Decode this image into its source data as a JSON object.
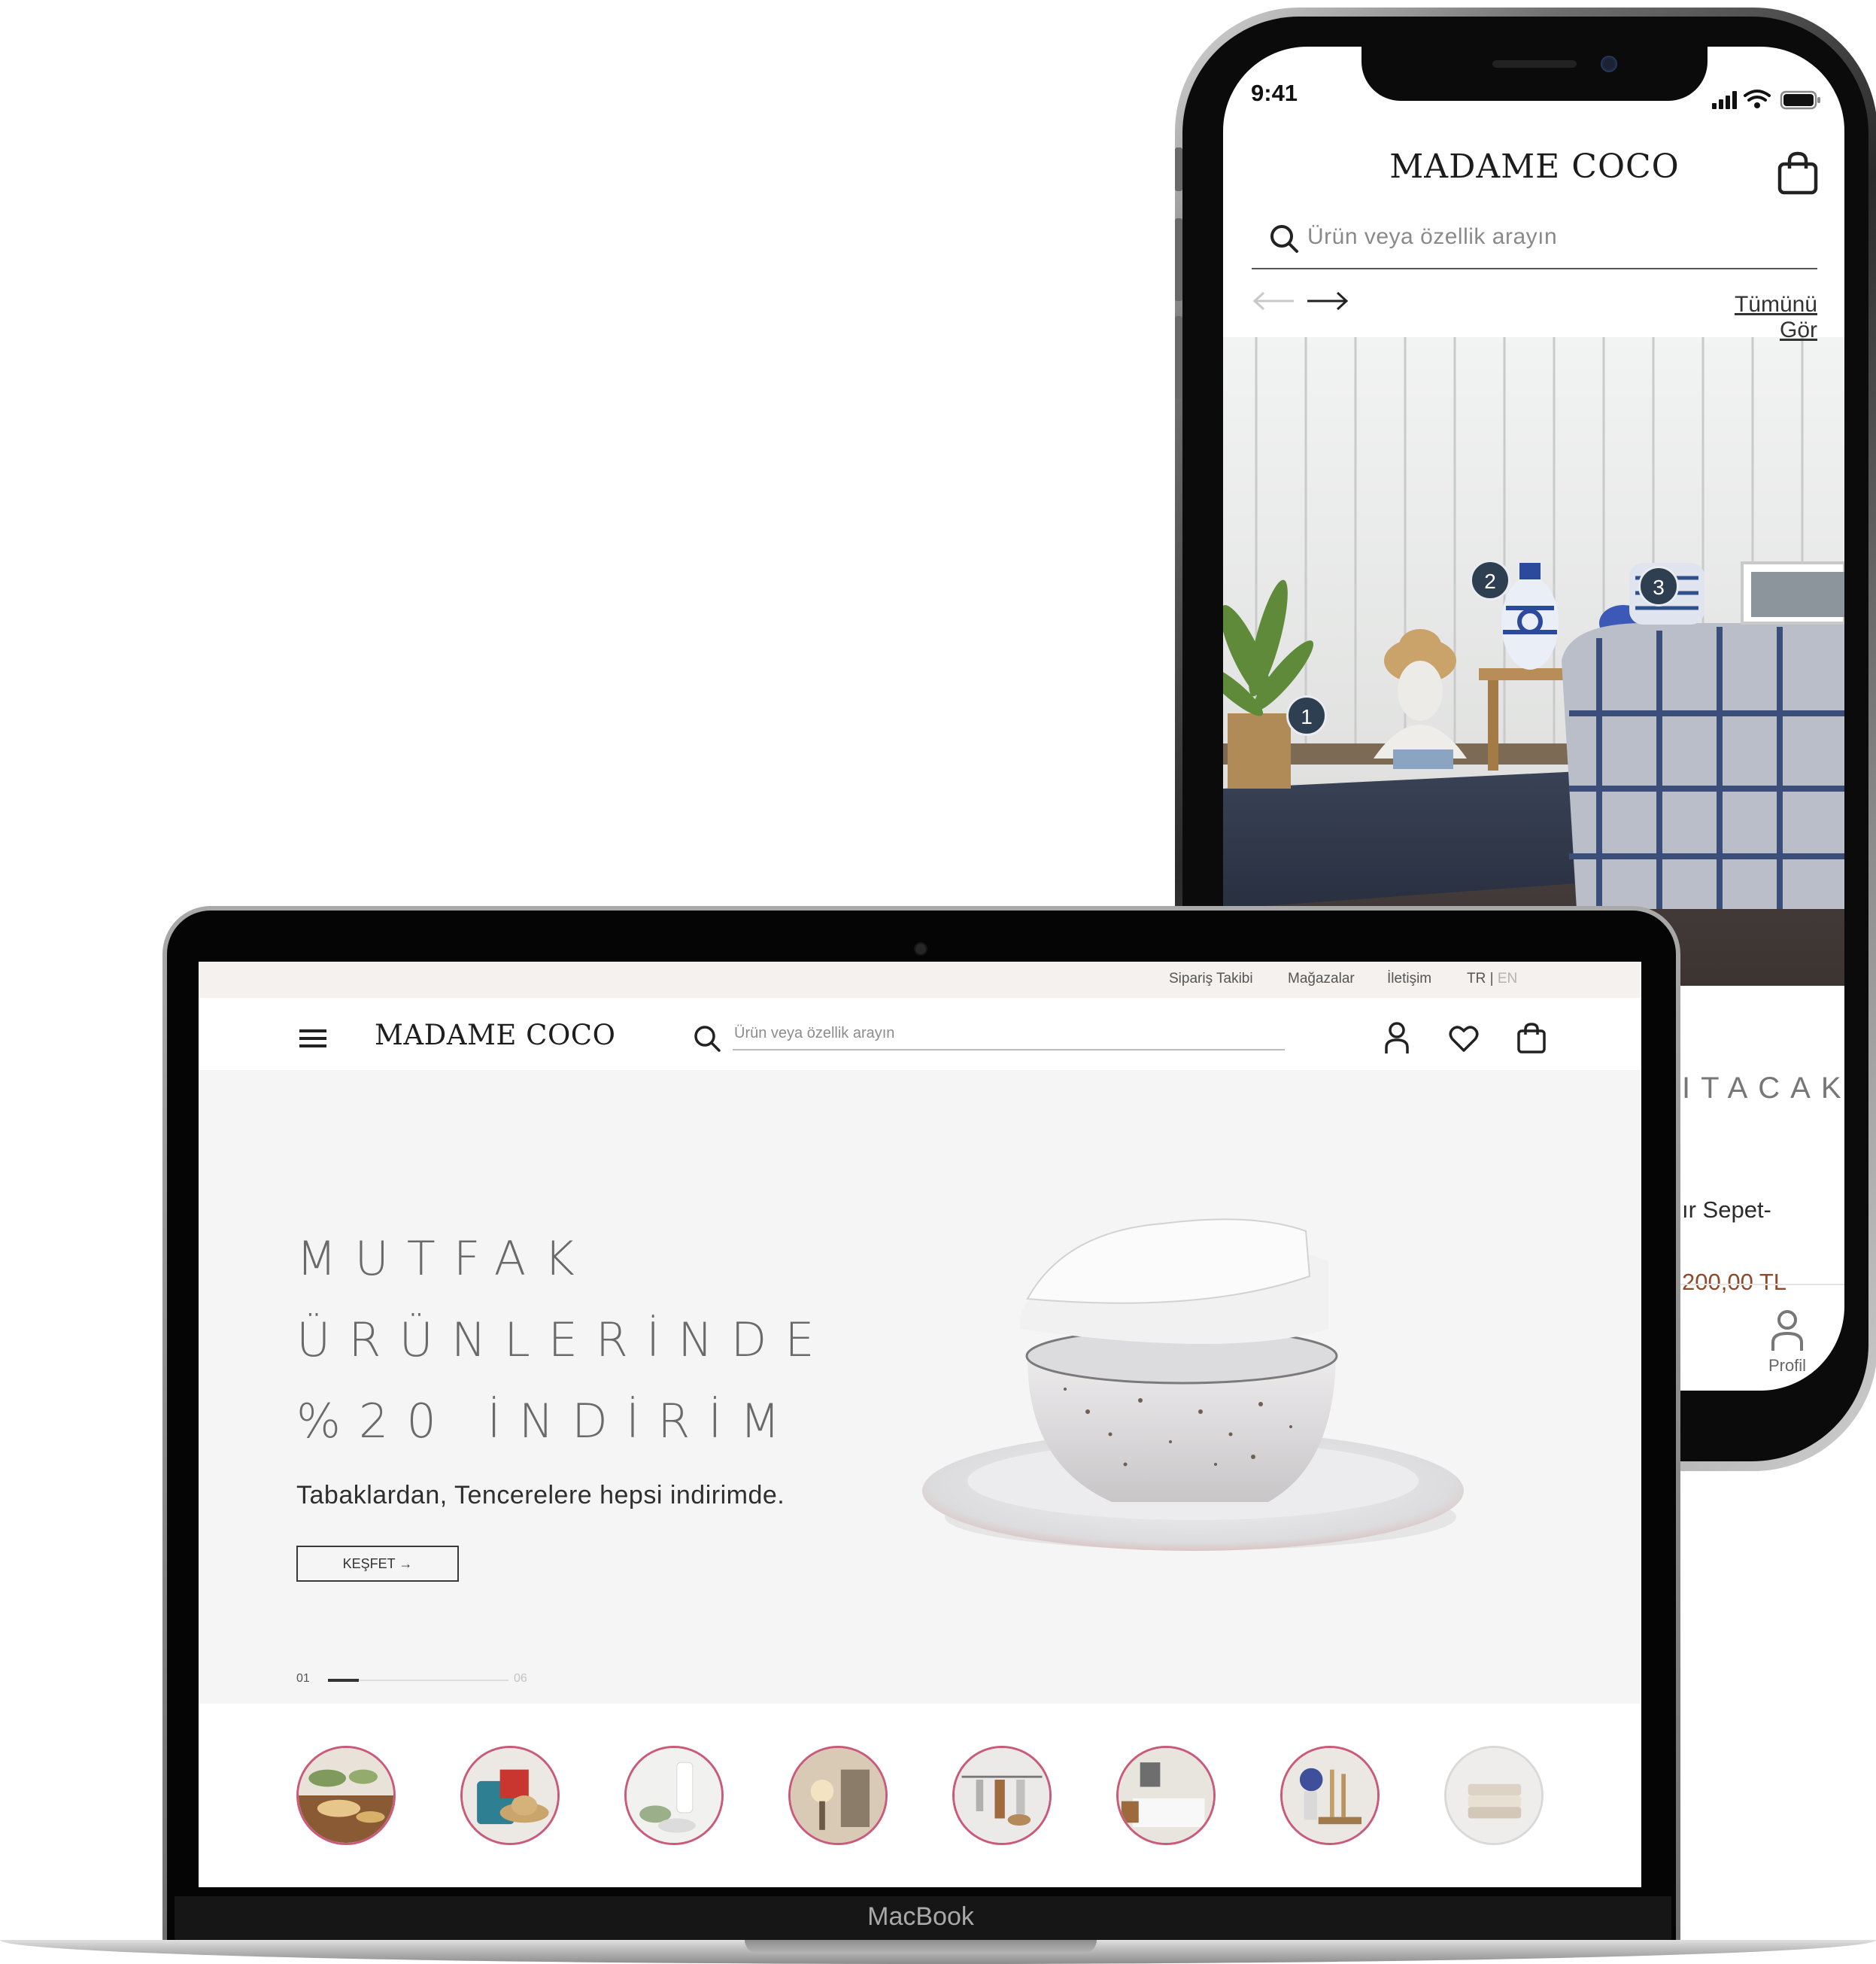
{
  "phone": {
    "status_time": "9:41",
    "logo": "MADAME COCO",
    "search_placeholder": "Ürün veya özellik arayın",
    "see_all": "Tümünü Gör",
    "hotspots": [
      "1",
      "2",
      "3"
    ],
    "partial_heading": "ITACAK",
    "partial_product": "ır Sepet-",
    "partial_price": "200,00 TL",
    "nav_profile": "Profil",
    "icons": [
      "signal-icon",
      "wifi-icon",
      "battery-icon",
      "bag-icon",
      "search-icon",
      "arrow-left-icon",
      "arrow-right-icon",
      "profile-icon"
    ]
  },
  "laptop": {
    "brand": "MacBook",
    "top_links": {
      "order_tracking": "Sipariş Takibi",
      "stores": "Mağazalar",
      "contact": "İletişim",
      "lang_tr": "TR",
      "lang_sep": "|",
      "lang_en": "EN"
    },
    "header": {
      "logo": "MADAME COCO",
      "search_placeholder": "Ürün veya özellik arayın",
      "icons": [
        "menu-icon",
        "search-icon",
        "user-icon",
        "heart-icon",
        "bag-icon"
      ]
    },
    "hero": {
      "line1": "MUTFAK",
      "line2": "ÜRÜNLERİNDE",
      "line3": "%20 İNDİRİM",
      "subtitle": "Tabaklardan, Tencerelere hepsi indirimde.",
      "button": "KEŞFET →",
      "slide_current": "01",
      "slide_total": "06",
      "slide_progress": 0.17
    },
    "categories": [
      "table-setting",
      "bags-hats",
      "bathroom",
      "lighting",
      "kitchen-tools",
      "bedroom",
      "decor-vases",
      "textiles"
    ]
  },
  "colors": {
    "accent_ring": "#c95a7a",
    "top_strip": "#f4f1ee",
    "hero_bg": "#f5f5f5",
    "price": "#8a4b2e",
    "hotspot": "#2f3f52"
  }
}
